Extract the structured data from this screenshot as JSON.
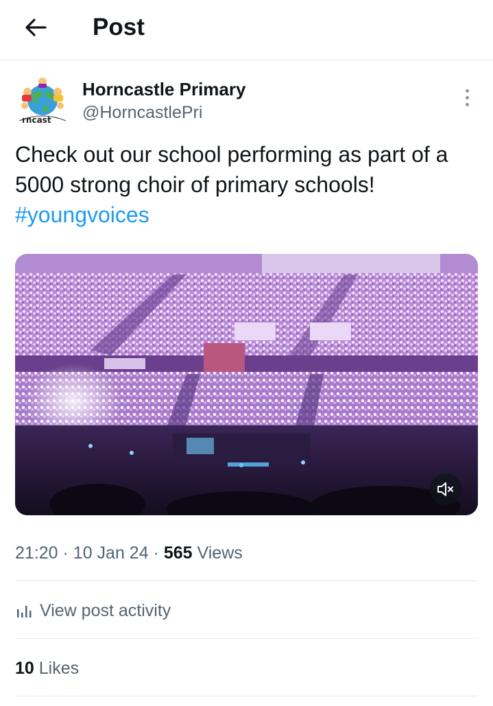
{
  "header": {
    "title": "Post",
    "back_icon": "arrow-left-icon"
  },
  "author": {
    "name": "Horncastle Primary",
    "handle": "@HorncastlePri",
    "avatar_logo_text": "rncast",
    "more_icon": "more-vertical-icon"
  },
  "post": {
    "text": "Check out our school performing as part of a 5000 strong choir of primary schools!",
    "hashtag": "#youngvoices"
  },
  "media": {
    "type": "video",
    "mute_icon": "speaker-muted-icon"
  },
  "meta": {
    "time": "21:20",
    "separator": "·",
    "date": "10 Jan 24",
    "views_count": "565",
    "views_label": "Views"
  },
  "activity": {
    "label": "View post activity",
    "icon": "bar-chart-icon"
  },
  "likes": {
    "count": "10",
    "label": "Likes"
  },
  "colors": {
    "link": "#1d9bf0",
    "text_primary": "#0f1419",
    "text_secondary": "#536471",
    "divider": "#e6e9ec"
  }
}
